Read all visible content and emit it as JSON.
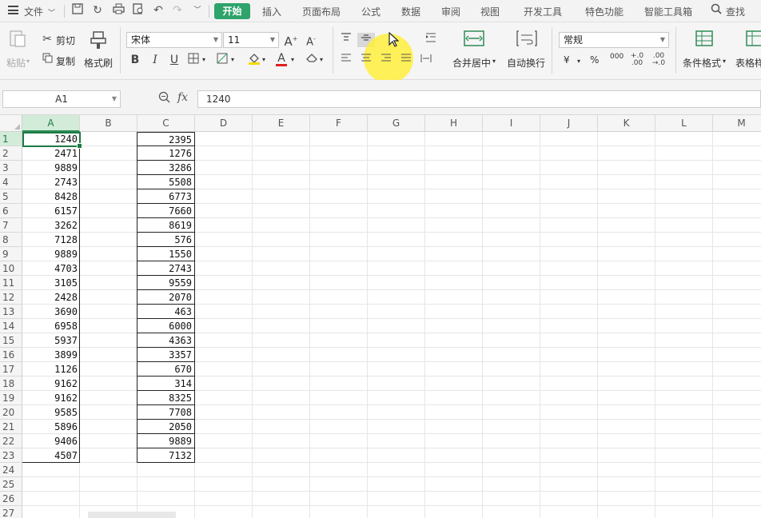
{
  "menubar": {
    "file_label": "文件",
    "tabs": [
      {
        "label": "开始",
        "active": true
      },
      {
        "label": "插入"
      },
      {
        "label": "页面布局"
      },
      {
        "label": "公式"
      },
      {
        "label": "数据"
      },
      {
        "label": "审阅"
      },
      {
        "label": "视图"
      },
      {
        "label": "开发工具"
      },
      {
        "label": "特色功能"
      },
      {
        "label": "智能工具箱"
      }
    ],
    "search_label": "查找",
    "accent_color": "#2ea36a"
  },
  "ribbon": {
    "paste_label": "粘贴",
    "cut_label": "剪切",
    "copy_label": "复制",
    "format_painter_label": "格式刷",
    "font_name": "宋体",
    "font_size": "11",
    "bold_label": "B",
    "italic_label": "I",
    "underline_label": "U",
    "font_color_label": "A",
    "merge_center_label": "合并居中",
    "wrap_text_label": "自动换行",
    "number_format": "常规",
    "currency_label": "¥",
    "percent_label": "%",
    "thousands_label": "000",
    "cond_format_label": "条件格式",
    "table_format_label": "表格样"
  },
  "formula_bar": {
    "name_box": "A1",
    "fx_label": "fx",
    "value": "1240"
  },
  "sheet": {
    "columns": [
      "A",
      "B",
      "C",
      "D",
      "E",
      "F",
      "G",
      "H",
      "I",
      "J",
      "K",
      "L",
      "M"
    ],
    "selected_column": "A",
    "rows": [
      "1",
      "2",
      "3",
      "4",
      "5",
      "6",
      "7",
      "8",
      "9",
      "10",
      "11",
      "12",
      "13",
      "14",
      "15",
      "16",
      "17",
      "18",
      "19",
      "20",
      "21",
      "22",
      "23",
      "24",
      "25",
      "26",
      "27"
    ],
    "col_a": [
      "1240",
      "2471",
      "9889",
      "2743",
      "8428",
      "6157",
      "3262",
      "7128",
      "9889",
      "4703",
      "3105",
      "2428",
      "3690",
      "6958",
      "5937",
      "3899",
      "1126",
      "9162",
      "9162",
      "9585",
      "5896",
      "9406",
      "4507"
    ],
    "col_c": [
      "2395",
      "1276",
      "3286",
      "5508",
      "6773",
      "7660",
      "8619",
      "576",
      "1550",
      "2743",
      "9559",
      "2070",
      "463",
      "6000",
      "4363",
      "3357",
      "670",
      "314",
      "8325",
      "7708",
      "2050",
      "9889",
      "7132"
    ]
  }
}
